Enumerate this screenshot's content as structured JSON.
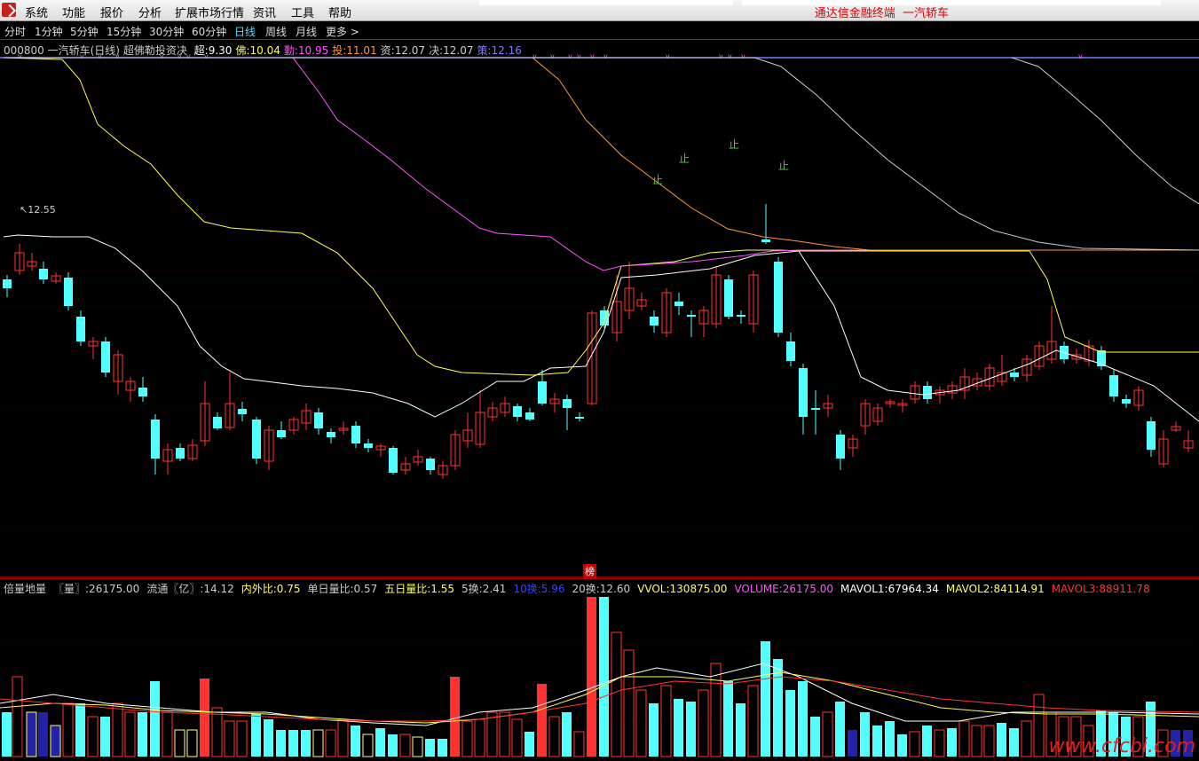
{
  "menu": [
    "系统",
    "功能",
    "报价",
    "分析",
    "扩展市场行情",
    "资讯",
    "工具",
    "帮助"
  ],
  "app_title": "通达信金融终端",
  "stock_name_top": "一汽轿车",
  "periods": [
    "分时",
    "1分钟",
    "5分钟",
    "15分钟",
    "30分钟",
    "60分钟",
    "日线",
    "周线",
    "月线",
    "更多 >"
  ],
  "active_period": "日线",
  "indicator": {
    "code_name": "000800 一汽轿车(日线)",
    "formula": "超佛勒投资决",
    "items": [
      {
        "label": "超",
        "value": "9.30",
        "color": "#ffffff"
      },
      {
        "label": "佛",
        "value": "10.04",
        "color": "#ffff55"
      },
      {
        "label": "勤",
        "value": "10.95",
        "color": "#ff55ff"
      },
      {
        "label": "投",
        "value": "11.01",
        "color": "#ff9933"
      },
      {
        "label": "资",
        "value": "12.07",
        "color": "#cccccc"
      },
      {
        "label": "决",
        "value": "12.07",
        "color": "#cccccc"
      },
      {
        "label": "策",
        "value": "12.16",
        "color": "#7b7bff"
      }
    ]
  },
  "price_marks": {
    "high_label": "12.55",
    "stop_char": "止",
    "bang_char": "榜"
  },
  "volume_panel": {
    "items": [
      {
        "label": "倍量地量",
        "value": "",
        "color": "#cccccc"
      },
      {
        "label": "〖量〗",
        "value": "26175.00",
        "color": "#cccccc"
      },
      {
        "label": "流通〖亿〗",
        "value": "14.12",
        "color": "#cccccc"
      },
      {
        "label": "内外比",
        "value": "0.75",
        "color": "#ffff55"
      },
      {
        "label": "单日量比",
        "value": "0.57",
        "color": "#cccccc"
      },
      {
        "label": "五日量比",
        "value": "1.55",
        "color": "#ffff55"
      },
      {
        "label": "5换",
        "value": "2.41",
        "color": "#cccccc"
      },
      {
        "label": "10换",
        "value": "5.96",
        "color": "#3344ff"
      },
      {
        "label": "20换",
        "value": "12.60",
        "color": "#cccccc"
      },
      {
        "label": "VVOL",
        "value": "130875.00",
        "color": "#ffff55"
      },
      {
        "label": "VOLUME",
        "value": "26175.00",
        "color": "#ff55ff"
      },
      {
        "label": "MAVOL1",
        "value": "67964.34",
        "color": "#ffffff"
      },
      {
        "label": "MAVOL2",
        "value": "84114.91",
        "color": "#ffff55"
      },
      {
        "label": "MAVOL3",
        "value": "88911.78",
        "color": "#ff3333"
      }
    ]
  },
  "watermark": "www.cfcbi.com",
  "colors": {
    "up": "#ff3232",
    "down": "#54ffff",
    "bg": "#000000",
    "grid": "#3a0000"
  }
}
